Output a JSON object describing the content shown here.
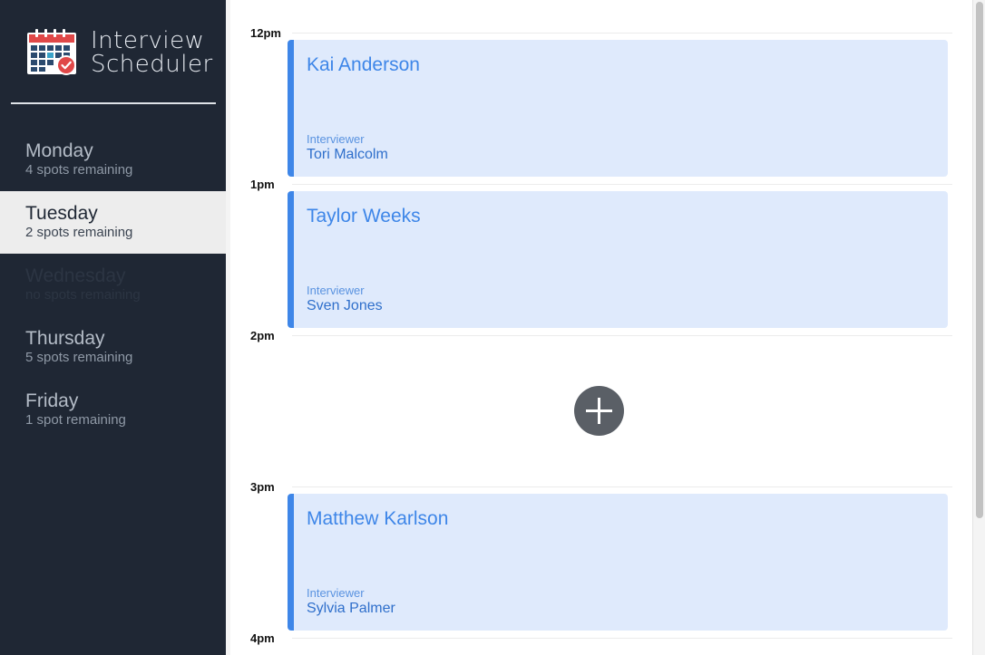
{
  "brand": {
    "title_line1": "Interview",
    "title_line2": "Scheduler",
    "logo_icon": "calendar-check-icon"
  },
  "days": [
    {
      "name": "Monday",
      "spots": "4 spots remaining",
      "state": "normal"
    },
    {
      "name": "Tuesday",
      "spots": "2 spots remaining",
      "state": "selected"
    },
    {
      "name": "Wednesday",
      "spots": "no spots remaining",
      "state": "full"
    },
    {
      "name": "Thursday",
      "spots": "5 spots remaining",
      "state": "normal"
    },
    {
      "name": "Friday",
      "spots": "1 spot remaining",
      "state": "normal"
    }
  ],
  "schedule": {
    "times": [
      "12pm",
      "1pm",
      "2pm",
      "3pm",
      "4pm"
    ],
    "appointments": [
      {
        "student": "Kai Anderson",
        "interviewer_label": "Interviewer",
        "interviewer": "Tori Malcolm"
      },
      {
        "student": "Taylor Weeks",
        "interviewer_label": "Interviewer",
        "interviewer": "Sven Jones"
      },
      {
        "student": "Matthew Karlson",
        "interviewer_label": "Interviewer",
        "interviewer": "Sylvia Palmer"
      }
    ],
    "add_icon": "plus-icon"
  },
  "colors": {
    "sidebar_bg": "#1f2734",
    "selected_day_bg": "#ededed",
    "card_bg": "#dfeafc",
    "card_accent": "#3e86e8",
    "add_button_bg": "#5a5f66"
  }
}
